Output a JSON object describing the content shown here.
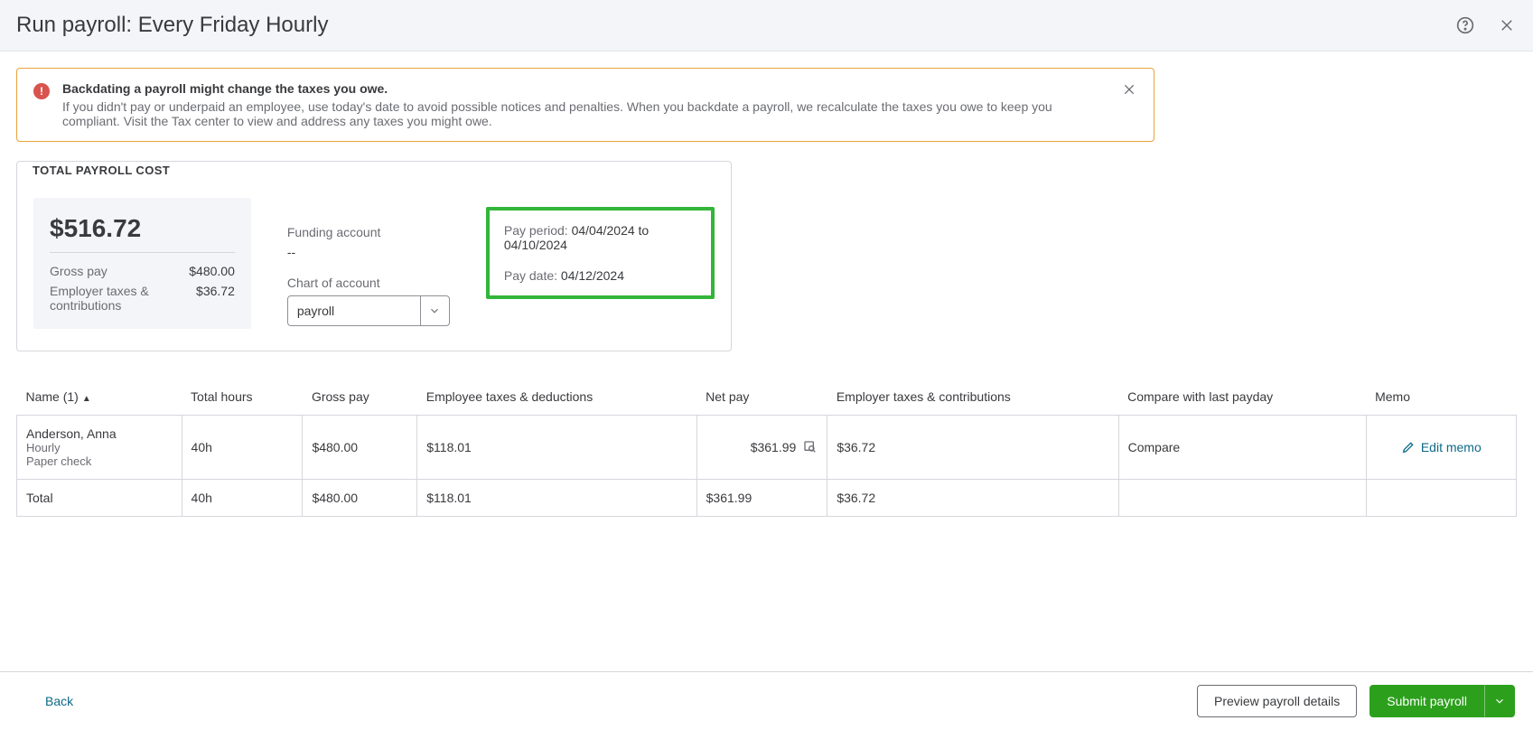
{
  "header": {
    "title": "Run payroll: Every Friday Hourly"
  },
  "alert": {
    "title": "Backdating a payroll might change the taxes you owe.",
    "text": "If you didn't pay or underpaid an employee, use today's date to avoid possible notices and penalties. When you backdate a payroll, we recalculate the taxes you owe to keep you compliant. Visit the Tax center to view and address any taxes you might owe."
  },
  "summary": {
    "title": "TOTAL PAYROLL COST",
    "total": "$516.72",
    "gross_label": "Gross pay",
    "gross_value": "$480.00",
    "emp_tax_label": "Employer taxes & contributions",
    "emp_tax_value": "$36.72",
    "funding_label": "Funding account",
    "funding_value": "--",
    "coa_label": "Chart of account",
    "coa_value": "payroll",
    "pay_period_label": "Pay period:",
    "pay_period_value": "04/04/2024 to 04/10/2024",
    "pay_date_label": "Pay date:",
    "pay_date_value": "04/12/2024"
  },
  "table": {
    "cols": {
      "name": "Name (1)",
      "hours": "Total hours",
      "gross": "Gross pay",
      "deduct": "Employee taxes & deductions",
      "net": "Net pay",
      "emp_tax": "Employer taxes & contributions",
      "compare": "Compare with last payday",
      "memo": "Memo"
    },
    "rows": [
      {
        "name": "Anderson, Anna",
        "type": "Hourly",
        "method": "Paper check",
        "hours": "40h",
        "gross": "$480.00",
        "deduct": "$118.01",
        "net": "$361.99",
        "emp_tax": "$36.72",
        "compare": "Compare",
        "memo": "Edit memo"
      }
    ],
    "total": {
      "label": "Total",
      "hours": "40h",
      "gross": "$480.00",
      "deduct": "$118.01",
      "net": "$361.99",
      "emp_tax": "$36.72"
    }
  },
  "footer": {
    "back": "Back",
    "preview": "Preview payroll details",
    "submit": "Submit payroll"
  }
}
